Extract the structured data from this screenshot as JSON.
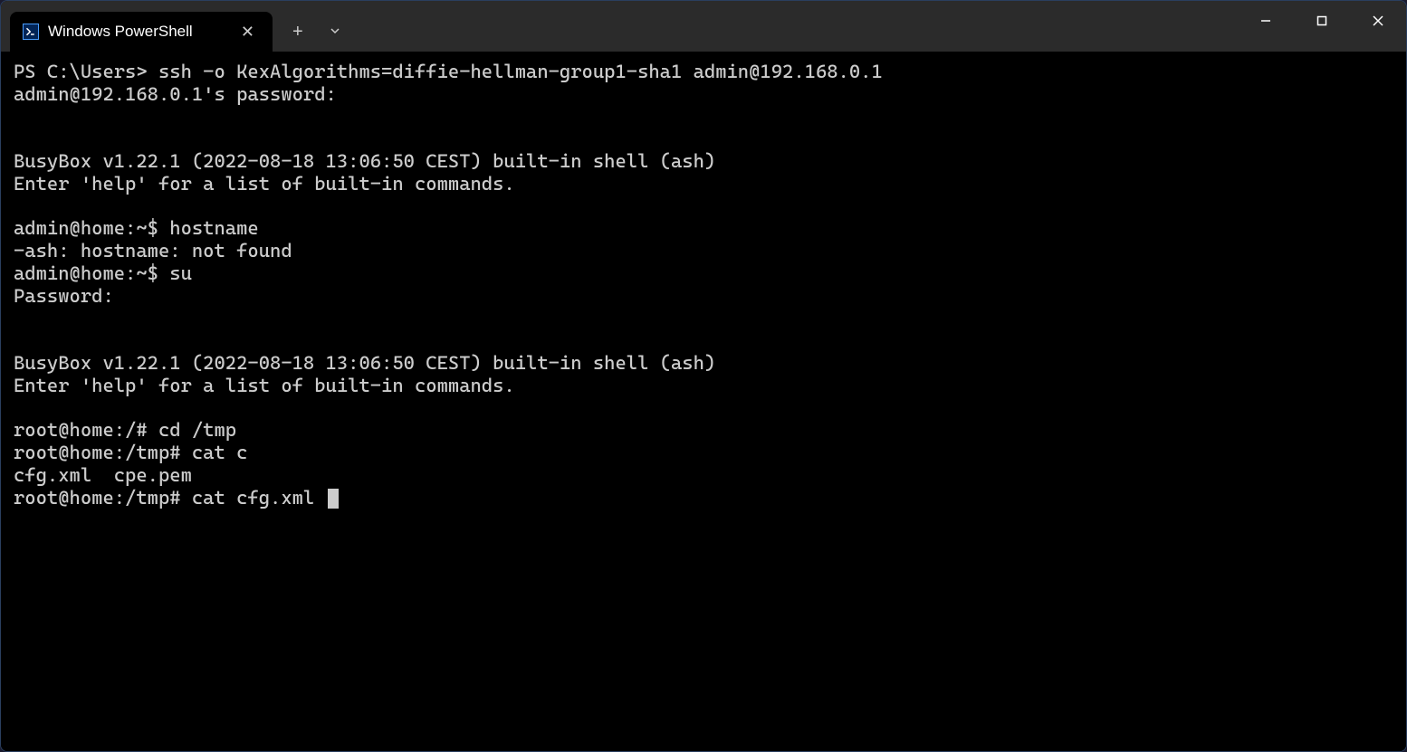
{
  "tab": {
    "title": "Windows PowerShell"
  },
  "terminal": {
    "lines": [
      "PS C:\\Users> ssh -o KexAlgorithms=diffie-hellman-group1-sha1 admin@192.168.0.1",
      "admin@192.168.0.1's password:",
      "",
      "",
      "BusyBox v1.22.1 (2022-08-18 13:06:50 CEST) built-in shell (ash)",
      "Enter 'help' for a list of built-in commands.",
      "",
      "admin@home:~$ hostname",
      "-ash: hostname: not found",
      "admin@home:~$ su",
      "Password:",
      "",
      "",
      "BusyBox v1.22.1 (2022-08-18 13:06:50 CEST) built-in shell (ash)",
      "Enter 'help' for a list of built-in commands.",
      "",
      "root@home:/# cd /tmp",
      "root@home:/tmp# cat c",
      "cfg.xml  cpe.pem",
      "root@home:/tmp# cat cfg.xml "
    ]
  }
}
